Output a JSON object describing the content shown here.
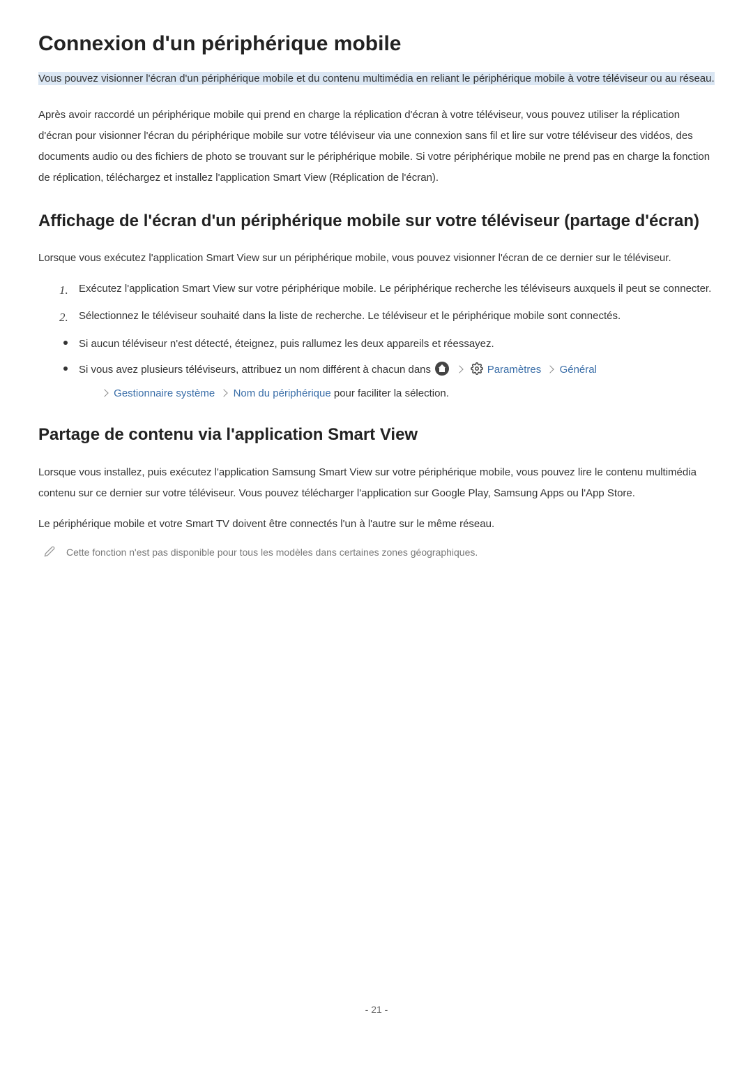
{
  "page": {
    "title": "Connexion d'un périphérique mobile",
    "summary_highlighted": "Vous pouvez visionner l'écran d'un périphérique mobile et du contenu multimédia en reliant le périphérique mobile à votre téléviseur ou au réseau.",
    "para1": "Après avoir raccordé un périphérique mobile qui prend en charge la réplication d'écran à votre téléviseur, vous pouvez utiliser la réplication d'écran pour visionner l'écran du périphérique mobile sur votre téléviseur via une connexion sans fil et lire sur votre téléviseur des vidéos, des documents audio ou des fichiers de photo se trouvant sur le périphérique mobile. Si votre périphérique mobile ne prend pas en charge la fonction de réplication, téléchargez et installez l'application Smart View (Réplication de l'écran)."
  },
  "section1": {
    "heading": "Affichage de l'écran d'un périphérique mobile sur votre téléviseur (partage d'écran)",
    "intro": "Lorsque vous exécutez l'application Smart View sur un périphérique mobile, vous pouvez visionner l'écran de ce dernier sur le téléviseur.",
    "step_num_1": "1.",
    "step_num_2": "2.",
    "step1": "Exécutez l'application Smart View sur votre périphérique mobile. Le périphérique recherche les téléviseurs auxquels il peut se connecter.",
    "step2": "Sélectionnez le téléviseur souhaité dans la liste de recherche. Le téléviseur et le périphérique mobile sont connectés.",
    "bullet1": "Si aucun téléviseur n'est détecté, éteignez, puis rallumez les deux appareils et réessayez.",
    "bullet2_prefix": "Si vous avez plusieurs téléviseurs, attribuez un nom différent à chacun dans ",
    "path": {
      "settings": "Paramètres",
      "general": "Général",
      "system_manager": "Gestionnaire système",
      "device_name": "Nom du périphérique"
    },
    "bullet2_suffix": " pour faciliter la sélection."
  },
  "section2": {
    "heading": "Partage de contenu via l'application Smart View",
    "para1": "Lorsque vous installez, puis exécutez l'application Samsung Smart View sur votre périphérique mobile, vous pouvez lire le contenu multimédia contenu sur ce dernier sur votre téléviseur. Vous pouvez télécharger l'application sur Google Play, Samsung Apps ou l'App Store.",
    "para2": "Le périphérique mobile et votre Smart TV doivent être connectés l'un à l'autre sur le même réseau.",
    "note": "Cette fonction n'est pas disponible pour tous les modèles dans certaines zones géographiques."
  },
  "footer": {
    "page_number": "- 21 -"
  }
}
